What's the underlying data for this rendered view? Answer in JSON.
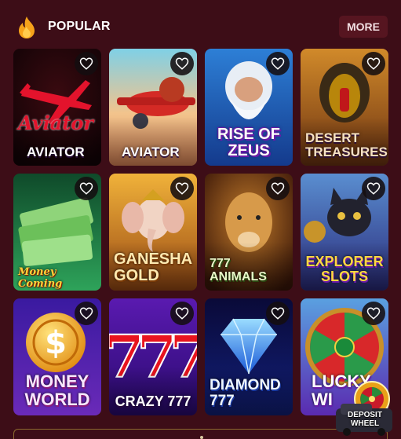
{
  "section": {
    "title": "POPULAR",
    "icon": "flame-icon",
    "more_label": "MORE"
  },
  "colors": {
    "background": "#3d0d17",
    "more_button": "#561520",
    "flame": "#f6a21a"
  },
  "games": [
    {
      "title": "AVIATOR",
      "art_text": "Aviator",
      "theme": "dark-red"
    },
    {
      "title": "AVIATOR",
      "theme": "red-plane"
    },
    {
      "title": "RISE OF\nZEUS",
      "theme": "zeus"
    },
    {
      "title": "DESERT\nTREASURES",
      "theme": "desert"
    },
    {
      "title": "",
      "art_text": "Money Coming",
      "theme": "money"
    },
    {
      "title": "GANESHA\nGOLD",
      "theme": "ganesha"
    },
    {
      "title": "777 ANIMALS",
      "theme": "cheetah"
    },
    {
      "title": "EXPLORER\nSLOTS",
      "theme": "cat"
    },
    {
      "title": "MONEY\nWORLD",
      "theme": "coin"
    },
    {
      "title": "CRAZY 777",
      "theme": "sevens"
    },
    {
      "title": "DIAMOND\n777",
      "theme": "diamond"
    },
    {
      "title": "LUCKY\nWI",
      "theme": "wheel"
    }
  ],
  "floating_promo": {
    "label": "DEPOSIT\nWHEEL"
  },
  "favorite_icon": "heart-outline-icon"
}
